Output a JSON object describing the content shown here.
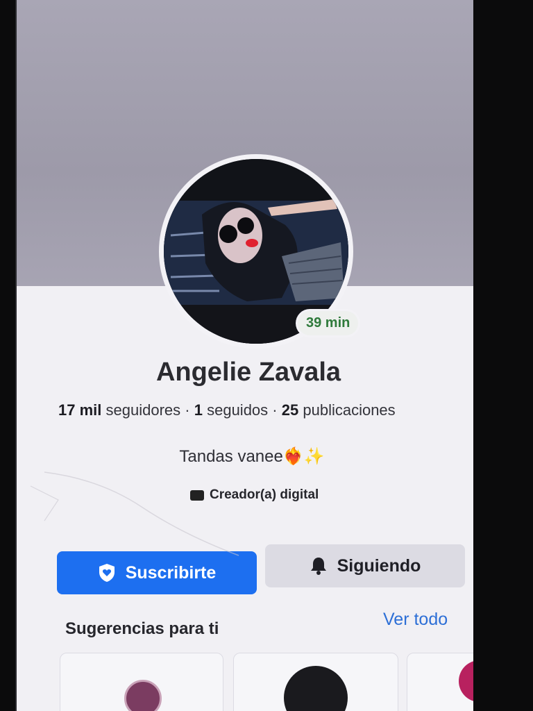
{
  "profile": {
    "name": "Angelie Zavala",
    "story_time": "39 min",
    "followers_count": "17 mil",
    "followers_label": "seguidores",
    "following_count": "1",
    "following_label": "seguidos",
    "posts_count": "25",
    "posts_label": "publicaciones",
    "bio": "Tandas vanee❤️‍🔥✨",
    "category": "Creador(a) digital"
  },
  "actions": {
    "subscribe_label": "Suscribirte",
    "following_label": "Siguiendo"
  },
  "suggestions": {
    "title": "Sugerencias para ti",
    "see_all": "Ver todo"
  },
  "colors": {
    "primary_button": "#1d6ff0",
    "secondary_button": "#dcdbe3",
    "link": "#2d6fd6",
    "story_badge_text": "#2f7a3b"
  },
  "icons": {
    "subscribe": "shield-heart-icon",
    "following": "bell-icon",
    "category": "briefcase-icon"
  }
}
